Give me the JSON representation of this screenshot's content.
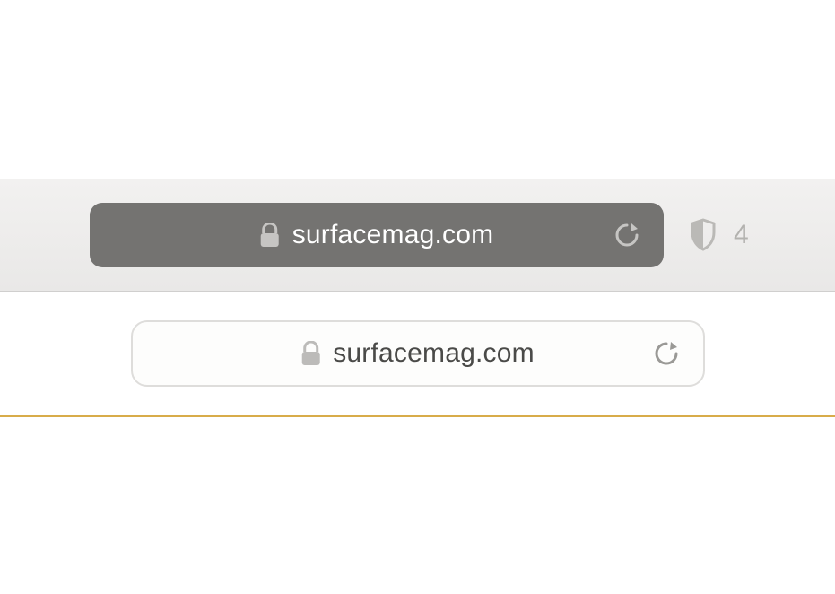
{
  "toolbar": {
    "address_bar": {
      "url": "surfacemag.com"
    },
    "privacy": {
      "tracker_count": "4"
    }
  },
  "content_bar": {
    "address_bar": {
      "url": "surfacemag.com"
    }
  }
}
